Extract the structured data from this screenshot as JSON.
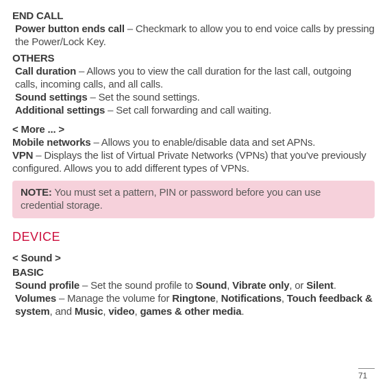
{
  "end_call": {
    "heading": "END CALL",
    "item1_label": "Power button ends call",
    "item1_desc": " – Checkmark to allow you to end voice calls by pressing the Power/Lock Key."
  },
  "others": {
    "heading": "OTHERS",
    "item1_label": "Call duration",
    "item1_desc": " – Allows you to view the call duration for the last call, outgoing calls, incoming calls, and all calls.",
    "item2_label": "Sound settings",
    "item2_desc": " – Set the sound settings.",
    "item3_label": "Additional settings",
    "item3_desc": " – Set call forwarding and call waiting."
  },
  "more": {
    "heading": "< More ... >",
    "item1_label": "Mobile networks",
    "item1_desc": " – Allows you to enable/disable data and set APNs.",
    "item2_label": "VPN",
    "item2_desc": " – Displays the list of Virtual Private Networks (VPNs) that you've previously configured. Allows you to add different types of VPNs."
  },
  "note": {
    "label": "NOTE:",
    "text": " You must set a pattern, PIN or password before you can use credential storage."
  },
  "device": {
    "heading": "DEVICE"
  },
  "sound": {
    "heading": "< Sound >",
    "basic_heading": "BASIC",
    "profile_label": "Sound profile",
    "profile_p1": " – Set the sound profile to ",
    "profile_b1": "Sound",
    "profile_p2": ", ",
    "profile_b2": "Vibrate only",
    "profile_p3": ", or ",
    "profile_b3": "Silent",
    "profile_p4": ".",
    "volumes_label": "Volumes",
    "volumes_p1": " – Manage the volume for ",
    "volumes_b1": "Ringtone",
    "volumes_p2": ", ",
    "volumes_b2": "Notifications",
    "volumes_p3": ", ",
    "volumes_b3": "Touch feedback & system",
    "volumes_p4": ", and ",
    "volumes_b4": "Music",
    "volumes_p5": ", ",
    "volumes_b5": "video",
    "volumes_p6": ", ",
    "volumes_b6": "games & other media",
    "volumes_p7": "."
  },
  "page_number": "71"
}
